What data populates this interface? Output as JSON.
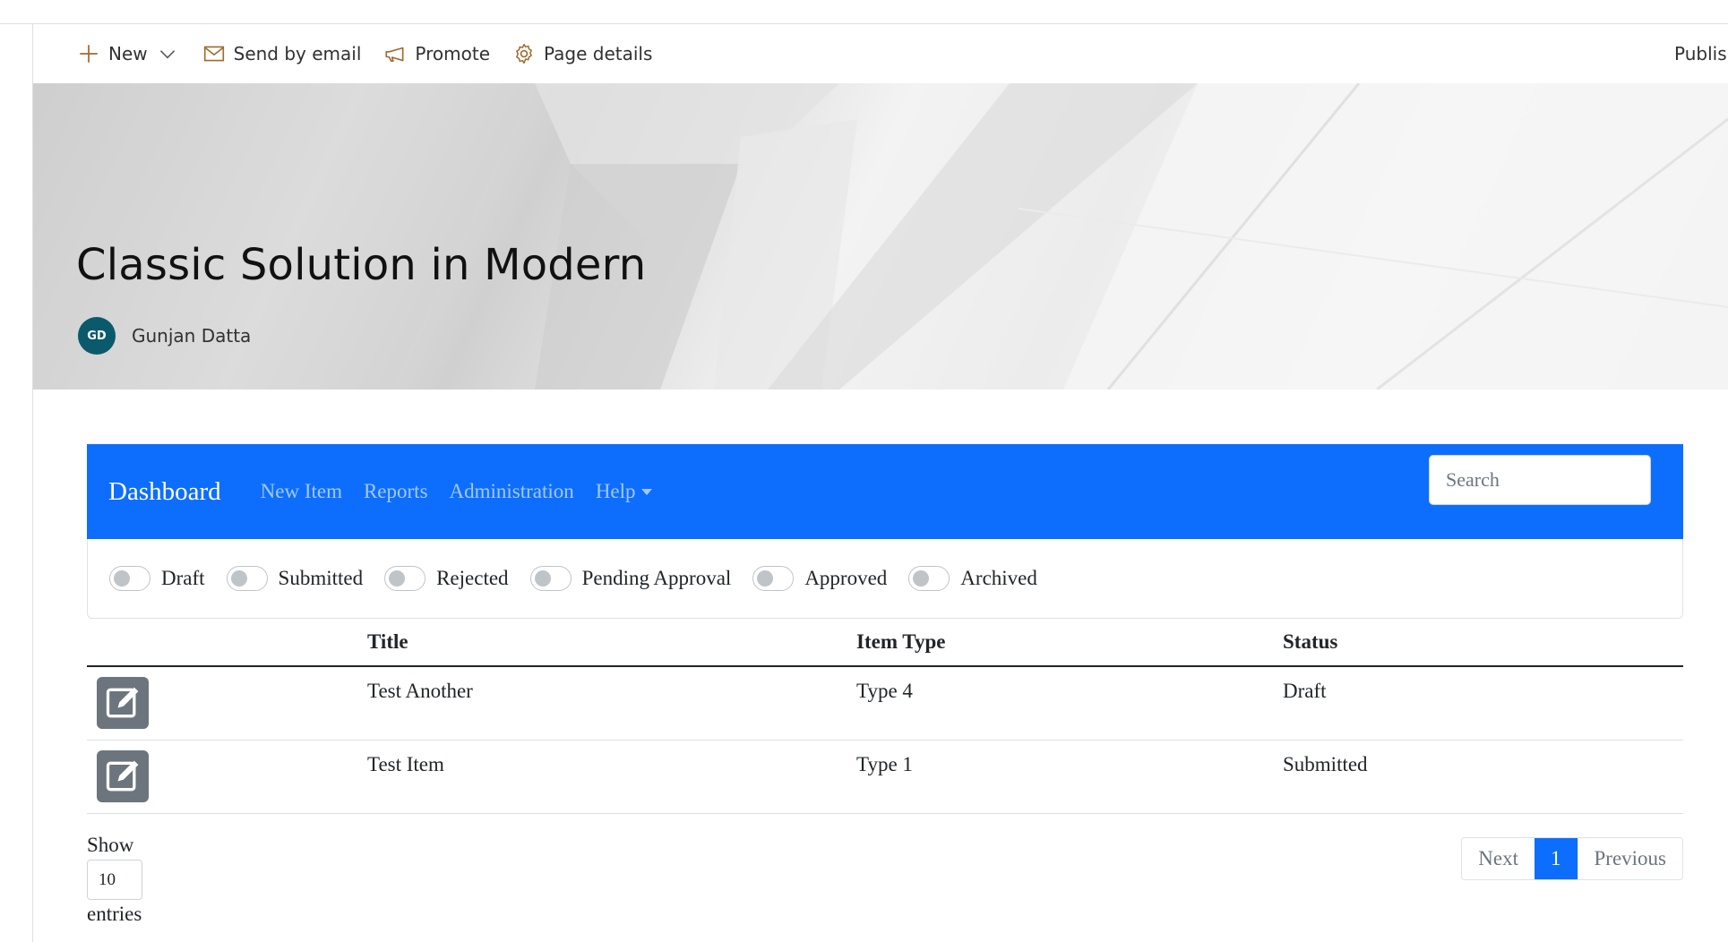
{
  "commandbar": {
    "new_label": "New",
    "email_label": "Send by email",
    "promote_label": "Promote",
    "details_label": "Page details",
    "publish_label": "Publish"
  },
  "hero": {
    "title": "Classic Solution in Modern",
    "author_initials": "GD",
    "author_name": "Gunjan Datta"
  },
  "navbar": {
    "brand": "Dashboard",
    "links": [
      "New Item",
      "Reports",
      "Administration",
      "Help"
    ],
    "search_placeholder": "Search"
  },
  "filters": [
    "Draft",
    "Submitted",
    "Rejected",
    "Pending Approval",
    "Approved",
    "Archived"
  ],
  "table": {
    "headers": [
      "",
      "Title",
      "Item Type",
      "Status"
    ],
    "rows": [
      {
        "title": "Test Another",
        "item_type": "Type 4",
        "status": "Draft"
      },
      {
        "title": "Test Item",
        "item_type": "Type 1",
        "status": "Submitted"
      }
    ]
  },
  "footer": {
    "show_label": "Show",
    "page_size": "10",
    "entries_label": "entries",
    "pager": [
      "Next",
      "1",
      "Previous"
    ]
  },
  "colors": {
    "navbar": "#0d6efd",
    "avatar": "#0a5a6b",
    "icon_accent": "#a06a2c",
    "edit_button": "#6c757d"
  }
}
